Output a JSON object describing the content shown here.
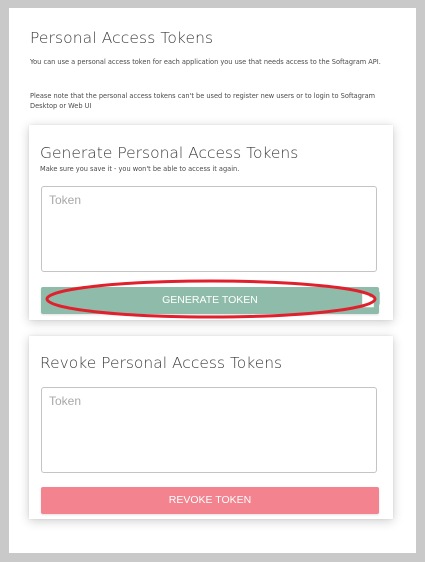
{
  "page": {
    "title": "Personal Access Tokens",
    "intro_1": "You can use a personal access token for each application you use that needs access to the Softagram API.",
    "intro_2": "Please note that the personal access tokens can't be used to register new users or to login to Softagram Desktop or Web UI"
  },
  "generate": {
    "title": "Generate Personal Access Tokens",
    "subtitle": "Make sure you save it - you won't be able to access it again.",
    "token_placeholder": "Token",
    "token_value": "",
    "button_label": "GENERATE TOKEN",
    "button_color": "#8fbcaa",
    "copy_icon": "copy-icon",
    "highlight_color": "#e0212d"
  },
  "revoke": {
    "title": "Revoke Personal Access Tokens",
    "token_placeholder": "Token",
    "token_value": "",
    "button_label": "REVOKE TOKEN",
    "button_color": "#f2838f"
  }
}
